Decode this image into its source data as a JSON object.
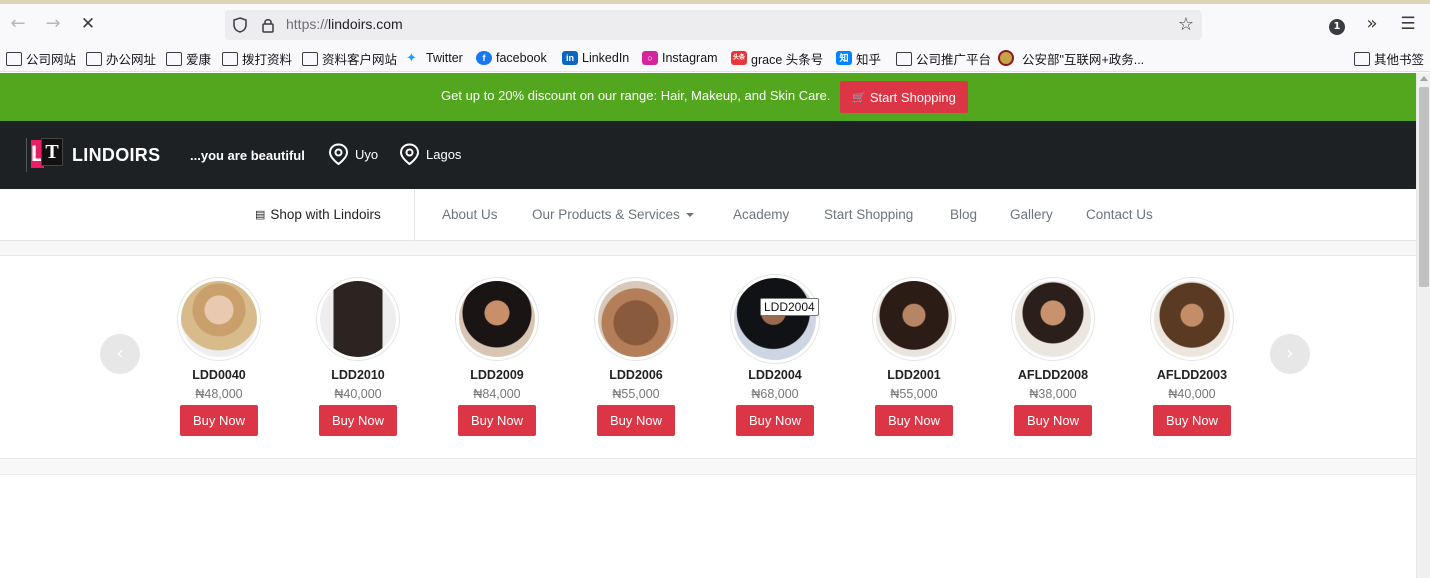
{
  "browser": {
    "url_protocol": "https://",
    "url_domain": "lindoirs.com",
    "notification_count": "1",
    "bookmarks": [
      {
        "label": "公司网站",
        "icon": "folder-icon"
      },
      {
        "label": "办公网址",
        "icon": "folder-icon"
      },
      {
        "label": "爱康",
        "icon": "folder-icon"
      },
      {
        "label": "拨打资料",
        "icon": "folder-icon"
      },
      {
        "label": "资料客户网站",
        "icon": "folder-icon"
      },
      {
        "label": "Twitter",
        "icon": "twitter-icon"
      },
      {
        "label": "facebook",
        "icon": "facebook-icon"
      },
      {
        "label": "LinkedIn",
        "icon": "linkedin-icon"
      },
      {
        "label": "Instagram",
        "icon": "instagram-icon"
      },
      {
        "label": "grace 头条号",
        "icon": "toutiao-icon"
      },
      {
        "label": "知乎",
        "icon": "zhihu-icon"
      },
      {
        "label": "公司推广平台",
        "icon": "folder-icon"
      },
      {
        "label": "公安部\"互联网+政务...",
        "icon": "police-emblem-icon"
      }
    ],
    "other_bookmarks": "其他书签"
  },
  "promo": {
    "text": "Get up to 20% discount on our range: Hair, Makeup, and Skin Care.",
    "button": "Start Shopping"
  },
  "header": {
    "brand": "LINDOIRS",
    "tagline": "...you are beautiful",
    "locations": [
      "Uyo",
      "Lagos"
    ]
  },
  "nav": {
    "shop": "Shop with Lindoirs",
    "links": [
      "About Us",
      "Our Products & Services",
      "Academy",
      "Start Shopping",
      "Blog",
      "Gallery",
      "Contact Us"
    ]
  },
  "products": [
    {
      "name": "LDD0040",
      "price": "₦48,000",
      "buy": "Buy Now"
    },
    {
      "name": "LDD2010",
      "price": "₦40,000",
      "buy": "Buy Now"
    },
    {
      "name": "LDD2009",
      "price": "₦84,000",
      "buy": "Buy Now"
    },
    {
      "name": "LDD2006",
      "price": "₦55,000",
      "buy": "Buy Now"
    },
    {
      "name": "LDD2004",
      "price": "₦68,000",
      "buy": "Buy Now"
    },
    {
      "name": "LDD2001",
      "price": "₦55,000",
      "buy": "Buy Now"
    },
    {
      "name": "AFLDD2008",
      "price": "₦38,000",
      "buy": "Buy Now"
    },
    {
      "name": "AFLDD2003",
      "price": "₦40,000",
      "buy": "Buy Now"
    }
  ],
  "tooltip": "LDD2004",
  "colors": {
    "promo_bg": "#52a71f",
    "header_bg": "#1e2124",
    "accent_red": "#dc3545",
    "brand_pink": "#e91e63"
  }
}
